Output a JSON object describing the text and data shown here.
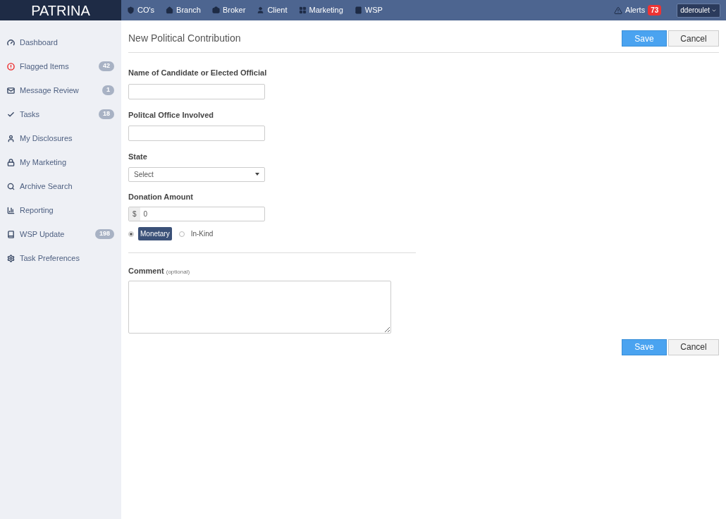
{
  "brand": "PATRINA",
  "nav": [
    {
      "label": "CO's"
    },
    {
      "label": "Branch"
    },
    {
      "label": "Broker"
    },
    {
      "label": "Client"
    },
    {
      "label": "Marketing"
    },
    {
      "label": "WSP"
    }
  ],
  "alerts": {
    "label": "Alerts",
    "count": "73"
  },
  "user": {
    "name": "dderoulet"
  },
  "sidebar": {
    "items": [
      {
        "label": "Dashboard"
      },
      {
        "label": "Flagged Items",
        "badge": "42"
      },
      {
        "label": "Message Review",
        "badge": "1"
      },
      {
        "label": "Tasks",
        "badge": "18"
      },
      {
        "label": "My Disclosures"
      },
      {
        "label": "My Marketing"
      },
      {
        "label": "Archive Search"
      },
      {
        "label": "Reporting"
      },
      {
        "label": "WSP Update",
        "badge": "198"
      },
      {
        "label": "Task Preferences"
      }
    ]
  },
  "page": {
    "title": "New Political Contribution",
    "buttons": {
      "save": "Save",
      "cancel": "Cancel"
    }
  },
  "form": {
    "fields": [
      {
        "kind": "text",
        "label": "Name of Candidate or Elected Official"
      },
      {
        "kind": "text",
        "label": "Politcal Office Involved"
      },
      {
        "kind": "select",
        "label": "State",
        "value": "Select"
      },
      {
        "kind": "money",
        "label": "Donation Amount",
        "prefix": "$",
        "value": "0"
      }
    ],
    "type_options": [
      {
        "label": "Monetary",
        "selected": true
      },
      {
        "label": "In-Kind",
        "selected": false
      }
    ],
    "comment": {
      "label": "Comment",
      "hint": "(optional)"
    }
  },
  "footer_buttons": {
    "save": "Save",
    "cancel": "Cancel"
  }
}
